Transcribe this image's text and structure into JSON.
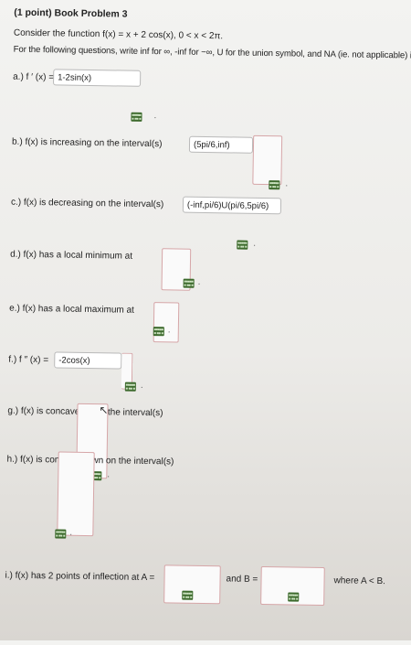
{
  "problem": {
    "title": "(1 point) Book Problem 3",
    "intro": "Consider the function f(x) = x + 2 cos(x),   0 < x < 2π.",
    "instructions": "For the following questions, write inf for ∞, -inf for −∞, U for the union symbol, and NA (ie. not applicable) if no such answer exists."
  },
  "questions": {
    "a": {
      "label": "a.) f ′ (x) =",
      "answer": "1-2sin(x)"
    },
    "b": {
      "label": "b.) f(x) is increasing on the interval(s)",
      "answer": "(5pi/6,inf)"
    },
    "c": {
      "label": "c.) f(x) is decreasing on the interval(s)",
      "answer": "(-inf,pi/6)U(pi/6,5pi/6)"
    },
    "d": {
      "label": "d.) f(x) has a local minimum at",
      "answer": ""
    },
    "e": {
      "label": "e.) f(x) has a local maximum at",
      "answer": ""
    },
    "f": {
      "label": "f.) f ″ (x) =",
      "answer": "-2cos(x)"
    },
    "g": {
      "label": "g.) f(x) is concave up on the interval(s)",
      "answer": ""
    },
    "h": {
      "label": "h.) f(x) is concave down on the interval(s)",
      "answer": ""
    },
    "i": {
      "label_start": "i.) f(x) has 2 points of inflection at A =",
      "label_mid": "and B =",
      "label_end": "where A < B."
    }
  },
  "icons": {
    "matrix": "answer-matrix-icon"
  },
  "colors": {
    "icon_green": "#3d6a2d",
    "box_border": "#d6a6a8"
  }
}
